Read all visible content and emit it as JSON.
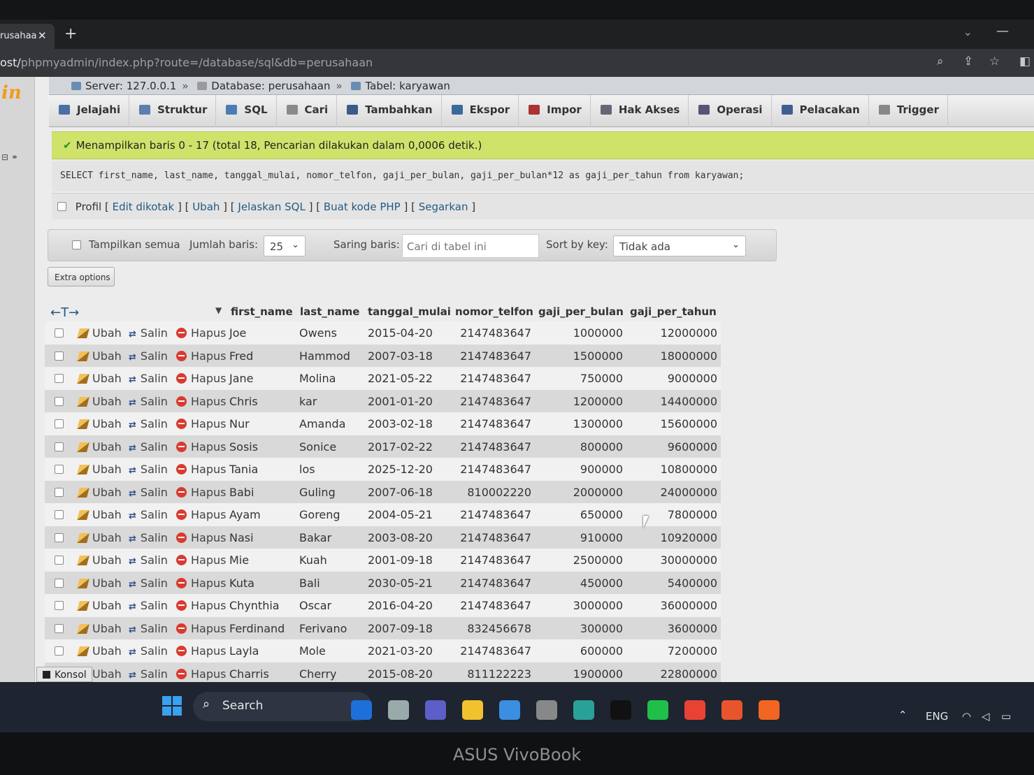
{
  "browser": {
    "tab_title": "rusahaa",
    "url_prefix": "ost/",
    "url_path": "phpmyadmin/index.php?route=/database/sql&db=perusahaan"
  },
  "breadcrumb": {
    "server": "Server: 127.0.0.1",
    "database": "Database: perusahaan",
    "table": "Tabel: karyawan"
  },
  "menu": [
    "Jelajahi",
    "Struktur",
    "SQL",
    "Cari",
    "Tambahkan",
    "Ekspor",
    "Impor",
    "Hak Akses",
    "Operasi",
    "Pelacakan",
    "Trigger"
  ],
  "menu_icon_colors": [
    "#4a6fa5",
    "#5a7fb0",
    "#4a7db5",
    "#8a8a8a",
    "#3a5a8a",
    "#3a6a9a",
    "#a33",
    "#667",
    "#557",
    "#3f5f8f",
    "#888"
  ],
  "message": "Menampilkan baris 0 - 17 (total 18, Pencarian dilakukan dalam 0,0006 detik.)",
  "sql": "SELECT first_name, last_name, tanggal_mulai, nomor_telfon, gaji_per_bulan, gaji_per_bulan*12 as gaji_per_tahun from karyawan;",
  "sql_links": {
    "profil": "Profil",
    "edit": "Edit dikotak",
    "ubah": "Ubah",
    "jelaskan": "Jelaskan SQL",
    "php": "Buat kode PHP",
    "segarkan": "Segarkan"
  },
  "nav_form": {
    "show_all": "Tampilkan semua",
    "rows_label": "Jumlah baris:",
    "rows_value": "25",
    "filter_label": "Saring baris:",
    "filter_placeholder": "Cari di tabel ini",
    "sort_label": "Sort by key:",
    "sort_value": "Tidak ada"
  },
  "extra_options": "Extra options",
  "row_actions": {
    "edit": "Ubah",
    "copy": "Salin",
    "delete": "Hapus"
  },
  "columns": [
    "first_name",
    "last_name",
    "tanggal_mulai",
    "nomor_telfon",
    "gaji_per_bulan",
    "gaji_per_tahun"
  ],
  "rows": [
    [
      "Joe",
      "Owens",
      "2015-04-20",
      "2147483647",
      "1000000",
      "12000000"
    ],
    [
      "Fred",
      "Hammod",
      "2007-03-18",
      "2147483647",
      "1500000",
      "18000000"
    ],
    [
      "Jane",
      "Molina",
      "2021-05-22",
      "2147483647",
      "750000",
      "9000000"
    ],
    [
      "Chris",
      "kar",
      "2001-01-20",
      "2147483647",
      "1200000",
      "14400000"
    ],
    [
      "Nur",
      "Amanda",
      "2003-02-18",
      "2147483647",
      "1300000",
      "15600000"
    ],
    [
      "Sosis",
      "Sonice",
      "2017-02-22",
      "2147483647",
      "800000",
      "9600000"
    ],
    [
      "Tania",
      "los",
      "2025-12-20",
      "2147483647",
      "900000",
      "10800000"
    ],
    [
      "Babi",
      "Guling",
      "2007-06-18",
      "810002220",
      "2000000",
      "24000000"
    ],
    [
      "Ayam",
      "Goreng",
      "2004-05-21",
      "2147483647",
      "650000",
      "7800000"
    ],
    [
      "Nasi",
      "Bakar",
      "2003-08-20",
      "2147483647",
      "910000",
      "10920000"
    ],
    [
      "Mie",
      "Kuah",
      "2001-09-18",
      "2147483647",
      "2500000",
      "30000000"
    ],
    [
      "Kuta",
      "Bali",
      "2030-05-21",
      "2147483647",
      "450000",
      "5400000"
    ],
    [
      "Chynthia",
      "Oscar",
      "2016-04-20",
      "2147483647",
      "3000000",
      "36000000"
    ],
    [
      "Ferdinand",
      "Ferivano",
      "2007-09-18",
      "832456678",
      "300000",
      "3600000"
    ],
    [
      "Layla",
      "Mole",
      "2021-03-20",
      "2147483647",
      "600000",
      "7200000"
    ],
    [
      "Charris",
      "Cherry",
      "2015-08-20",
      "811122223",
      "1900000",
      "22800000"
    ]
  ],
  "console": "Konsol",
  "taskbar": {
    "search": "Search",
    "lang": "ENG",
    "icon_colors": [
      "#1e6fd9",
      "#9aa",
      "#5b5fc7",
      "#f2c12e",
      "#3b8ee0",
      "#888",
      "#2aa198",
      "#111",
      "#1fbf4a",
      "#e94235",
      "#e8552d",
      "#f26522"
    ]
  },
  "brand": "ASUS VivoBook"
}
